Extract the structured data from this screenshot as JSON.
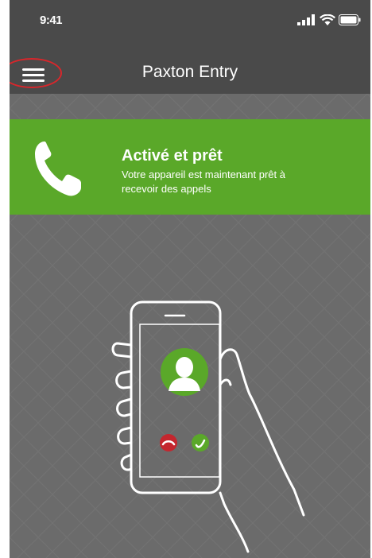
{
  "status_bar": {
    "time": "9:41"
  },
  "header": {
    "title": "Paxton Entry"
  },
  "banner": {
    "title": "Activé et prêt",
    "description_line1": "Votre appareil est maintenant prêt à",
    "description_line2": "recevoir des appels"
  },
  "colors": {
    "header_bg": "#4a4a4a",
    "accent_green": "#5aa829",
    "background": "#6b6b6b",
    "decline_red": "#c4262e",
    "highlight_circle": "#d9262b"
  },
  "icons": [
    "menu-icon",
    "phone-icon",
    "signal-icon",
    "wifi-icon",
    "battery-icon",
    "avatar-icon",
    "decline-call-icon",
    "accept-call-icon"
  ]
}
